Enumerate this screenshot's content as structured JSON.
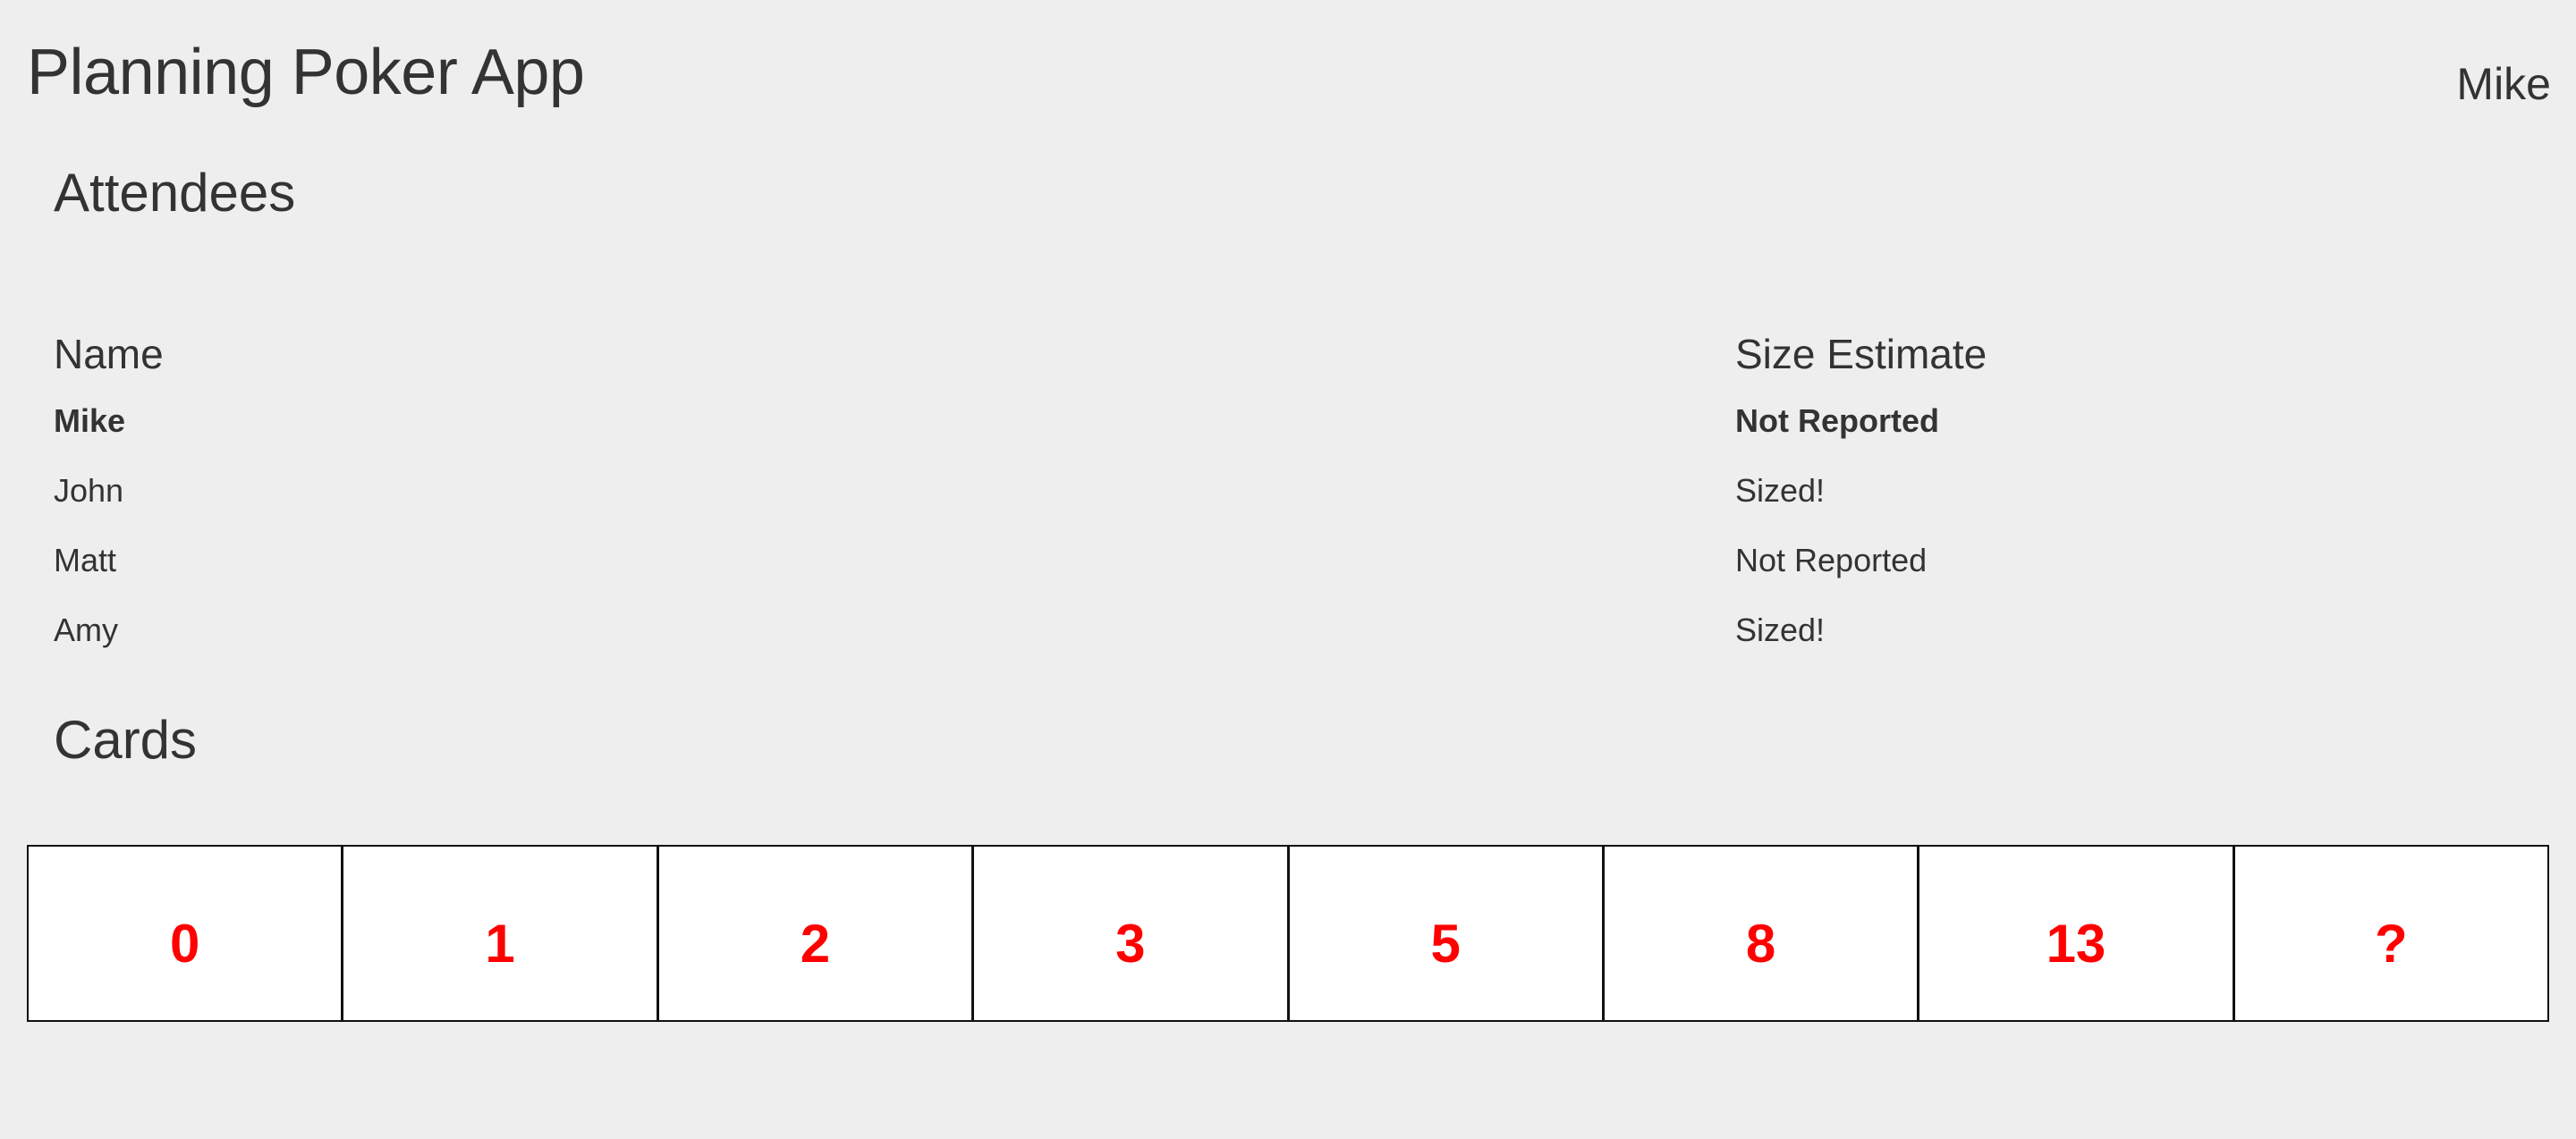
{
  "app": {
    "title": "Planning Poker App",
    "current_user": "Mike"
  },
  "attendees": {
    "heading": "Attendees",
    "columns": [
      "Name",
      "Size Estimate"
    ],
    "rows": [
      {
        "name": "Mike",
        "estimate": "Not Reported",
        "is_current_user": true
      },
      {
        "name": "John",
        "estimate": "Sized!",
        "is_current_user": false
      },
      {
        "name": "Matt",
        "estimate": "Not Reported",
        "is_current_user": false
      },
      {
        "name": "Amy",
        "estimate": "Sized!",
        "is_current_user": false
      }
    ]
  },
  "cards": {
    "heading": "Cards",
    "values": [
      "0",
      "1",
      "2",
      "3",
      "5",
      "8",
      "13",
      "?"
    ],
    "value_color": "#ff0000"
  },
  "colors": {
    "background": "#eeeeee",
    "text": "#333333",
    "card_background": "#ffffff",
    "card_border": "#111111"
  }
}
